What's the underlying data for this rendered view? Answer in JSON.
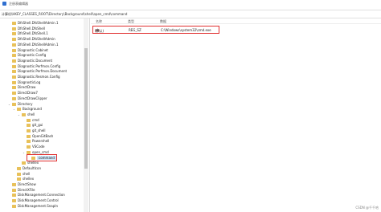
{
  "window": {
    "title": "注册表编辑器"
  },
  "address": {
    "path": "计算机\\HKEY_CLASSES_ROOT\\Directory\\Background\\shell\\open_cmd\\command"
  },
  "tree": {
    "items": [
      {
        "label": "DfsShell.DfsShellAdmin.1",
        "depth": 1,
        "arrow": ""
      },
      {
        "label": "DfsShell.DfsShell",
        "depth": 1,
        "arrow": ""
      },
      {
        "label": "DfsShell.DfsShell.1",
        "depth": 1,
        "arrow": ""
      },
      {
        "label": "DfsShell.DfsShellAdmin",
        "depth": 1,
        "arrow": ""
      },
      {
        "label": "DfsShell.DfsShellAdmin.1",
        "depth": 1,
        "arrow": ""
      },
      {
        "label": "Diagnostic.Cabinet",
        "depth": 1,
        "arrow": ""
      },
      {
        "label": "Diagnostic.Config",
        "depth": 1,
        "arrow": ""
      },
      {
        "label": "Diagnostic.Document",
        "depth": 1,
        "arrow": ""
      },
      {
        "label": "Diagnostic.Perfmon.Config",
        "depth": 1,
        "arrow": ""
      },
      {
        "label": "Diagnostic.Perfmon.Document",
        "depth": 1,
        "arrow": ""
      },
      {
        "label": "Diagnostic.Resmon.Config",
        "depth": 1,
        "arrow": ""
      },
      {
        "label": "DiagnosticLog",
        "depth": 1,
        "arrow": ""
      },
      {
        "label": "DirectDraw",
        "depth": 1,
        "arrow": ""
      },
      {
        "label": "DirectDraw7",
        "depth": 1,
        "arrow": ""
      },
      {
        "label": "DirectDrawClipper",
        "depth": 1,
        "arrow": ""
      },
      {
        "label": "Directory",
        "depth": 1,
        "arrow": "v"
      },
      {
        "label": "Background",
        "depth": 2,
        "arrow": "v"
      },
      {
        "label": "shell",
        "depth": 3,
        "arrow": "v"
      },
      {
        "label": "cmd",
        "depth": 4,
        "arrow": ""
      },
      {
        "label": "git_gui",
        "depth": 4,
        "arrow": ""
      },
      {
        "label": "git_shell",
        "depth": 4,
        "arrow": ""
      },
      {
        "label": "OpenGitBash",
        "depth": 4,
        "arrow": ""
      },
      {
        "label": "Powershell",
        "depth": 4,
        "arrow": ""
      },
      {
        "label": "VSCode",
        "depth": 4,
        "arrow": ""
      },
      {
        "label": "open_cmd",
        "depth": 4,
        "arrow": "v"
      },
      {
        "label": "command",
        "depth": 5,
        "arrow": "",
        "selected": true
      },
      {
        "label": "shellex",
        "depth": 3,
        "arrow": ""
      },
      {
        "label": "DefaultIcon",
        "depth": 2,
        "arrow": ""
      },
      {
        "label": "shell",
        "depth": 2,
        "arrow": ""
      },
      {
        "label": "shellex",
        "depth": 2,
        "arrow": ""
      },
      {
        "label": "DirectShow",
        "depth": 1,
        "arrow": ""
      },
      {
        "label": "DirectXFile",
        "depth": 1,
        "arrow": ""
      },
      {
        "label": "DiskManagement.Connection",
        "depth": 1,
        "arrow": ""
      },
      {
        "label": "DiskManagement.Control",
        "depth": 1,
        "arrow": ""
      },
      {
        "label": "DiskManagement.SnapIn",
        "depth": 1,
        "arrow": ""
      }
    ]
  },
  "values": {
    "headers": {
      "name": "名称",
      "type": "类型",
      "data": "数据"
    },
    "rows": [
      {
        "name": "(默认)",
        "type": "REG_SZ",
        "data": "C:\\Windows\\system32\\cmd.exe"
      }
    ]
  },
  "watermark": "CSDN @千千哈"
}
